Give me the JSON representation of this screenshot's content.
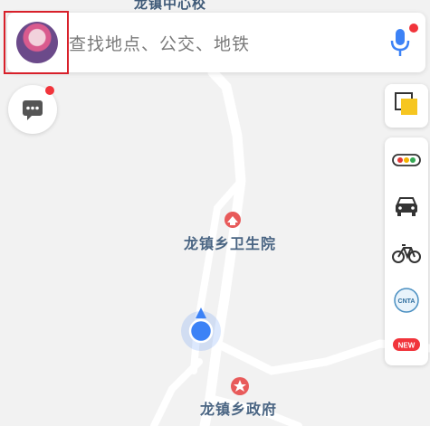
{
  "map": {
    "top_label": "龙镇中心校",
    "pois": [
      {
        "name": "龙镇乡卫生院",
        "icon": "hospital-icon"
      },
      {
        "name": "龙镇乡政府",
        "icon": "government-icon"
      }
    ]
  },
  "search": {
    "placeholder": "查找地点、公交、地铁",
    "voice_icon": "microphone-icon",
    "avatar_highlighted": true
  },
  "left_controls": {
    "message_icon": "message-icon",
    "has_notification": true
  },
  "right_controls": {
    "layers_icon": "layers-icon",
    "tools": [
      {
        "name": "traffic",
        "icon": "traffic-light-icon"
      },
      {
        "name": "taxi",
        "icon": "taxi-icon"
      },
      {
        "name": "bike",
        "icon": "bicycle-icon"
      },
      {
        "name": "cnta",
        "icon": "cnta-logo-icon",
        "label": "CNTA"
      },
      {
        "name": "new",
        "icon": "new-badge-icon",
        "label": "NEW"
      }
    ]
  },
  "colors": {
    "accent_blue": "#3c82f6",
    "alert_red": "#f1343b",
    "highlight_box": "#d8202a",
    "label_text": "#4a6583"
  }
}
